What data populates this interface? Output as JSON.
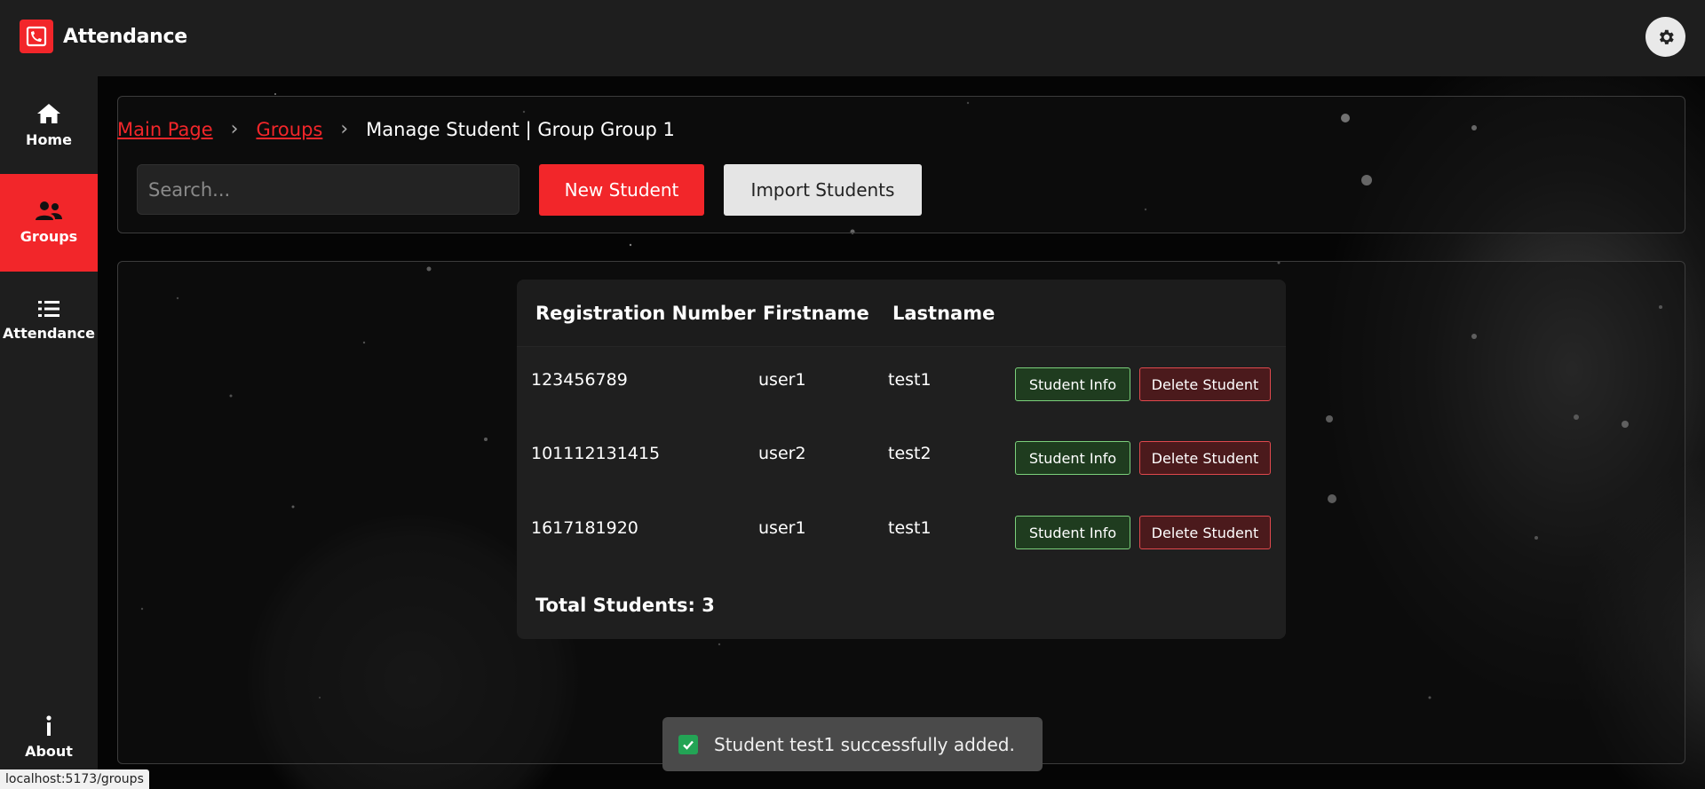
{
  "app": {
    "name": "Attendance",
    "brand_color": "#f2262a"
  },
  "sidebar": {
    "items": [
      {
        "label": "Home",
        "icon": "home-icon",
        "active": false
      },
      {
        "label": "Groups",
        "icon": "users-icon",
        "active": true
      },
      {
        "label": "Attendance",
        "icon": "list-icon",
        "active": false
      },
      {
        "label": "About",
        "icon": "info-icon",
        "active": false
      }
    ]
  },
  "breadcrumb": {
    "items": [
      {
        "label": "Main Page",
        "link": true
      },
      {
        "label": "Groups",
        "link": true
      },
      {
        "label": "Manage Student | Group Group 1",
        "link": false
      }
    ],
    "separator": "›"
  },
  "toolbar": {
    "search_placeholder": "Search...",
    "new_student_label": "New Student",
    "import_label": "Import Students"
  },
  "table": {
    "columns": [
      "Registration Number",
      "Firstname",
      "Lastname"
    ],
    "rows": [
      {
        "reg": "123456789",
        "first": "user1",
        "last": "test1"
      },
      {
        "reg": "101112131415",
        "first": "user2",
        "last": "test2"
      },
      {
        "reg": "1617181920",
        "first": "user1",
        "last": "test1"
      }
    ],
    "info_label": "Student Info",
    "delete_label": "Delete Student",
    "total_label": "Total Students: 3"
  },
  "toast": {
    "message": "Student test1 successfully added.",
    "status_color": "#23a455"
  },
  "status_bar": {
    "url": "localhost:5173/groups"
  }
}
